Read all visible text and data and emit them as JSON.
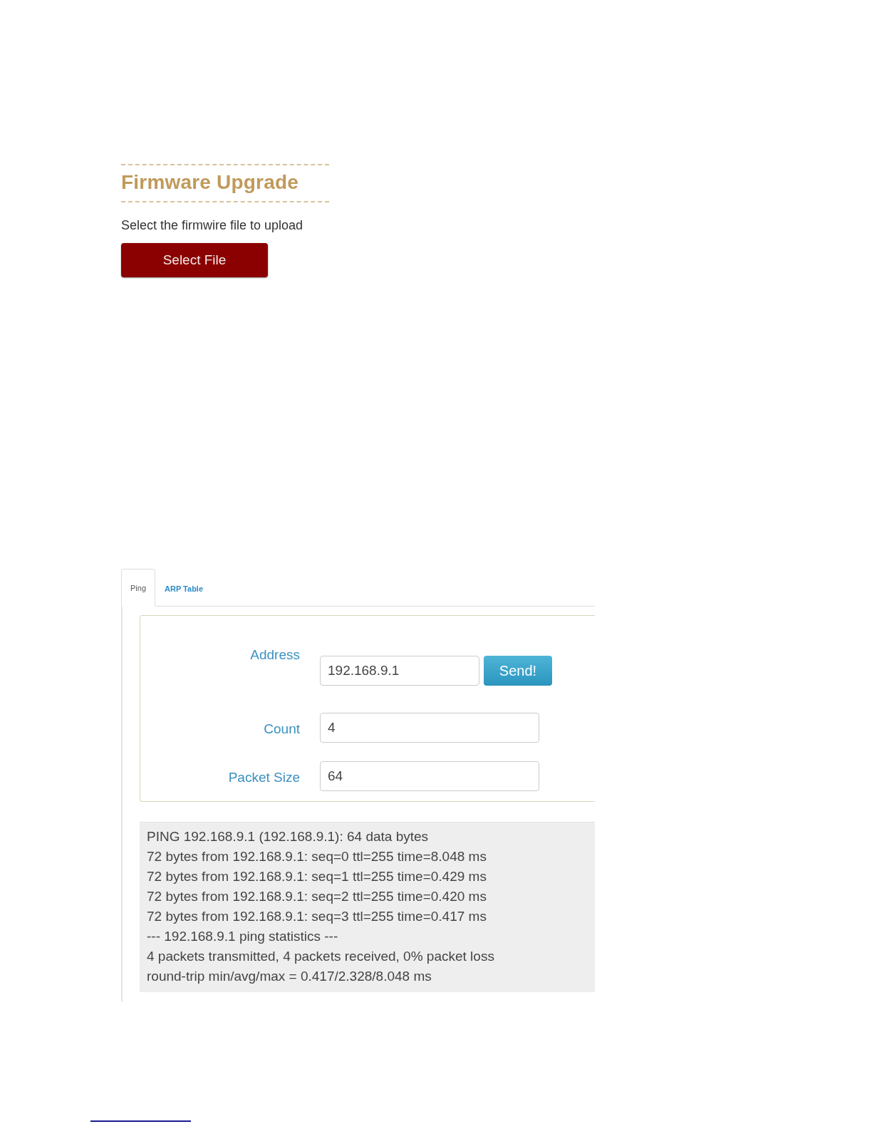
{
  "firmware": {
    "title": "Firmware Upgrade",
    "instruction": "Select the firmwire file to upload",
    "button": "Select File"
  },
  "tabs": [
    {
      "label": "Ping",
      "selected": true
    },
    {
      "label": "ARP Table",
      "selected": false
    }
  ],
  "ping_form": {
    "fields": [
      {
        "label": "Address",
        "value": "192.168.9.1",
        "button": "Send!"
      },
      {
        "label": "Count",
        "value": "4"
      },
      {
        "label": "Packet Size",
        "value": "64"
      }
    ]
  },
  "output": [
    "PING 192.168.9.1 (192.168.9.1): 64 data bytes",
    "72 bytes from 192.168.9.1: seq=0 ttl=255 time=8.048 ms",
    "72 bytes from 192.168.9.1: seq=1 ttl=255 time=0.429 ms",
    "72 bytes from 192.168.9.1: seq=2 ttl=255 time=0.420 ms",
    "72 bytes from 192.168.9.1: seq=3 ttl=255 time=0.417 ms",
    "--- 192.168.9.1 ping statistics ---",
    "4 packets transmitted, 4 packets received, 0% packet loss",
    "round-trip min/avg/max = 0.417/2.328/8.048 ms"
  ]
}
